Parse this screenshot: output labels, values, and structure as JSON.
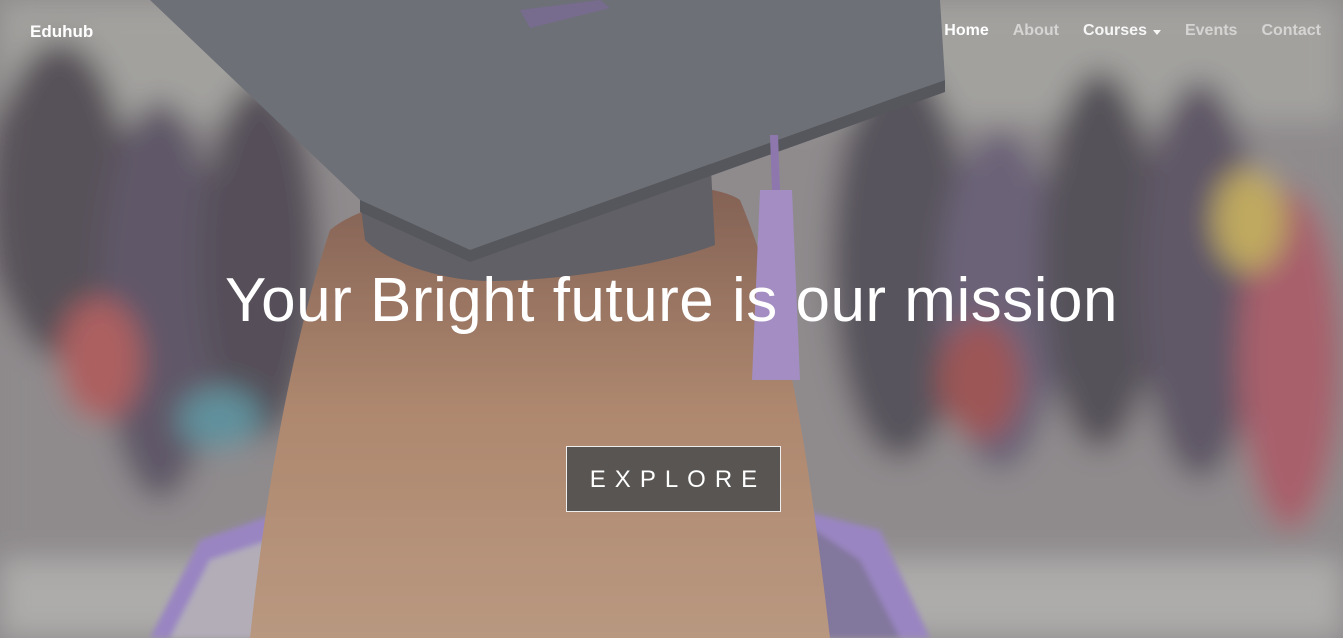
{
  "navbar": {
    "brand": "Eduhub",
    "links": [
      {
        "label": "Home"
      },
      {
        "label": "About"
      },
      {
        "label": "Courses"
      },
      {
        "label": "Events"
      },
      {
        "label": "Contact"
      }
    ]
  },
  "hero": {
    "headline": "Your Bright future is our mission",
    "cta_label": "EXPLORE"
  },
  "colors": {
    "overlay": "#969696",
    "button_bg": "#505050",
    "cap": "#5a5d68",
    "tassel": "#a98ad6",
    "hair": "#b07a5a",
    "gown": "#9b7fd6"
  }
}
